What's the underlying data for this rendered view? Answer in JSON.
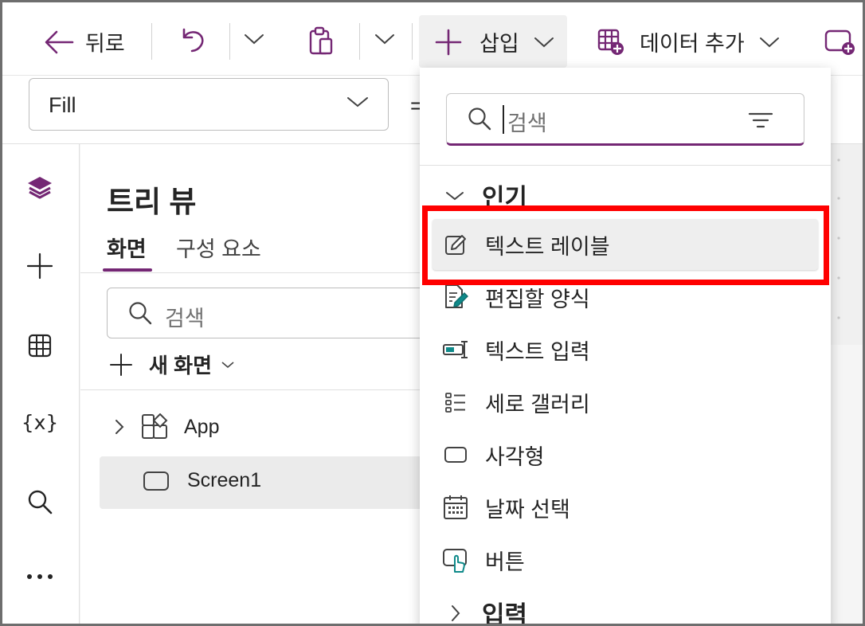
{
  "toolbar": {
    "back_label": "뒤로",
    "insert_label": "삽입",
    "add_data_label": "데이터 추가"
  },
  "formula_bar": {
    "property_value": "Fill",
    "equals": "="
  },
  "tree_view": {
    "title": "트리 뷰",
    "tabs": [
      {
        "label": "화면"
      },
      {
        "label": "구성 요소"
      }
    ],
    "search_placeholder": "검색",
    "new_screen_label": "새 화면",
    "nodes": [
      {
        "label": "App"
      },
      {
        "label": "Screen1"
      }
    ]
  },
  "insert_menu": {
    "search_placeholder": "검색",
    "sections": [
      {
        "title": "인기",
        "items": [
          {
            "label": "텍스트 레이블",
            "icon": "edit-pencil-icon"
          },
          {
            "label": "편집할 양식",
            "icon": "form-edit-icon"
          },
          {
            "label": "텍스트 입력",
            "icon": "text-input-icon"
          },
          {
            "label": "세로 갤러리",
            "icon": "vertical-gallery-icon"
          },
          {
            "label": "사각형",
            "icon": "rectangle-icon"
          },
          {
            "label": "날짜 선택",
            "icon": "calendar-icon"
          },
          {
            "label": "버튼",
            "icon": "button-pointer-icon"
          }
        ]
      },
      {
        "title": "입력"
      }
    ]
  },
  "colors": {
    "accent": "#742774",
    "highlight": "#ff0000",
    "hover_bg": "#eeeeee"
  }
}
